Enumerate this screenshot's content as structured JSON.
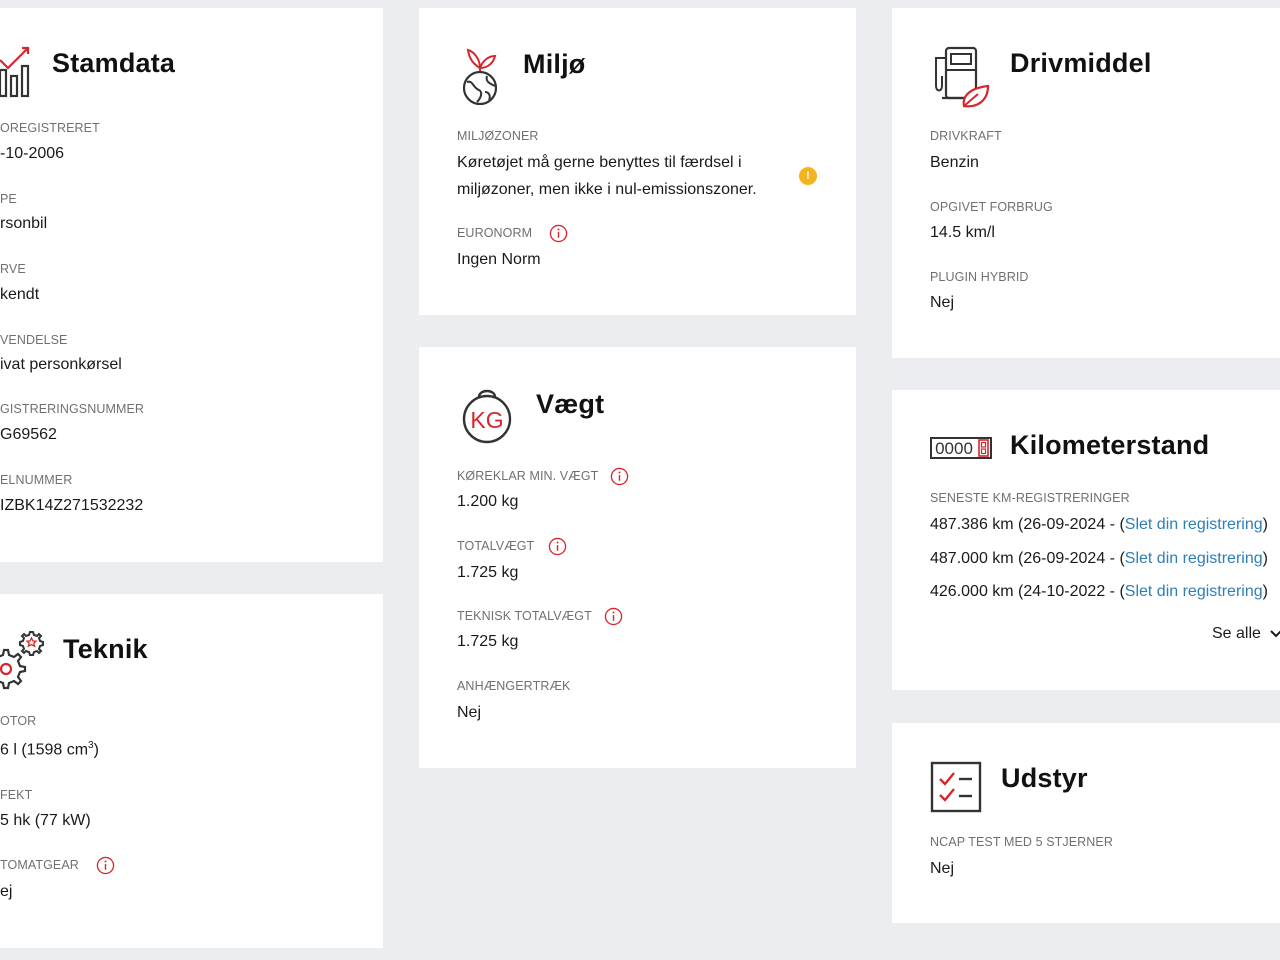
{
  "stamdata": {
    "title": "Stamdata",
    "fields": [
      {
        "label": "OREGISTRERET",
        "value": "-10-2006"
      },
      {
        "label": "PE",
        "value": "rsonbil"
      },
      {
        "label": "RVE",
        "value": "kendt"
      },
      {
        "label": "VENDELSE",
        "value": "ivat personkørsel"
      },
      {
        "label": "GISTRERINGSNUMMER",
        "value": "G69562"
      },
      {
        "label": "ELNUMMER",
        "value": "IZBK14Z271532232"
      }
    ]
  },
  "teknik": {
    "title": "Teknik",
    "motor": {
      "label": "OTOR",
      "value_main": "6 l (1598 cm",
      "value_sup": "3",
      "value_end": ")"
    },
    "effekt": {
      "label": "FEKT",
      "value": "5 hk (77 kW)"
    },
    "gear": {
      "label": "TOMATGEAR",
      "value": "ej"
    }
  },
  "miljo": {
    "title": "Miljø",
    "zones": {
      "label": "MILJØZONER",
      "value": "Køretøjet må gerne benyttes til færdsel i miljøzoner, men ikke i nul-emissionszoner."
    },
    "euronorm": {
      "label": "EURONORM",
      "value": "Ingen Norm"
    }
  },
  "vaegt": {
    "title": "Vægt",
    "icon_text": "KG",
    "fields": [
      {
        "label": "KØREKLAR MIN. VÆGT",
        "value": "1.200 kg"
      },
      {
        "label": "TOTALVÆGT",
        "value": "1.725 kg"
      },
      {
        "label": "TEKNISK TOTALVÆGT",
        "value": "1.725 kg"
      },
      {
        "label": "ANHÆNGERTRÆK",
        "value": "Nej"
      }
    ]
  },
  "drivmiddel": {
    "title": "Drivmiddel",
    "fields": [
      {
        "label": "DRIVKRAFT",
        "value": "Benzin"
      },
      {
        "label": "OPGIVET FORBRUG",
        "value": "14.5 km/l"
      },
      {
        "label": "PLUGIN HYBRID",
        "value": "Nej"
      }
    ]
  },
  "kilometerstand": {
    "title": "Kilometerstand",
    "icon_text": "0000",
    "label": "SENESTE KM-REGISTRERINGER",
    "rows": [
      {
        "text": "487.386 km (26-09-2024 - (",
        "link": "Slet din registrering",
        "end": ")"
      },
      {
        "text": "487.000 km (26-09-2024 - (",
        "link": "Slet din registrering",
        "end": ")"
      },
      {
        "text": "426.000 km (24-10-2022 - (",
        "link": "Slet din registrering",
        "end": ")"
      }
    ],
    "see_all": "Se alle"
  },
  "udstyr": {
    "title": "Udstyr",
    "ncap": {
      "label": "NCAP TEST MED 5 STJERNER",
      "value": "Nej"
    }
  },
  "colors": {
    "accent": "#d7262e",
    "link": "#2c7fb8",
    "warn": "#f5b31e",
    "background": "#ebedf0"
  }
}
